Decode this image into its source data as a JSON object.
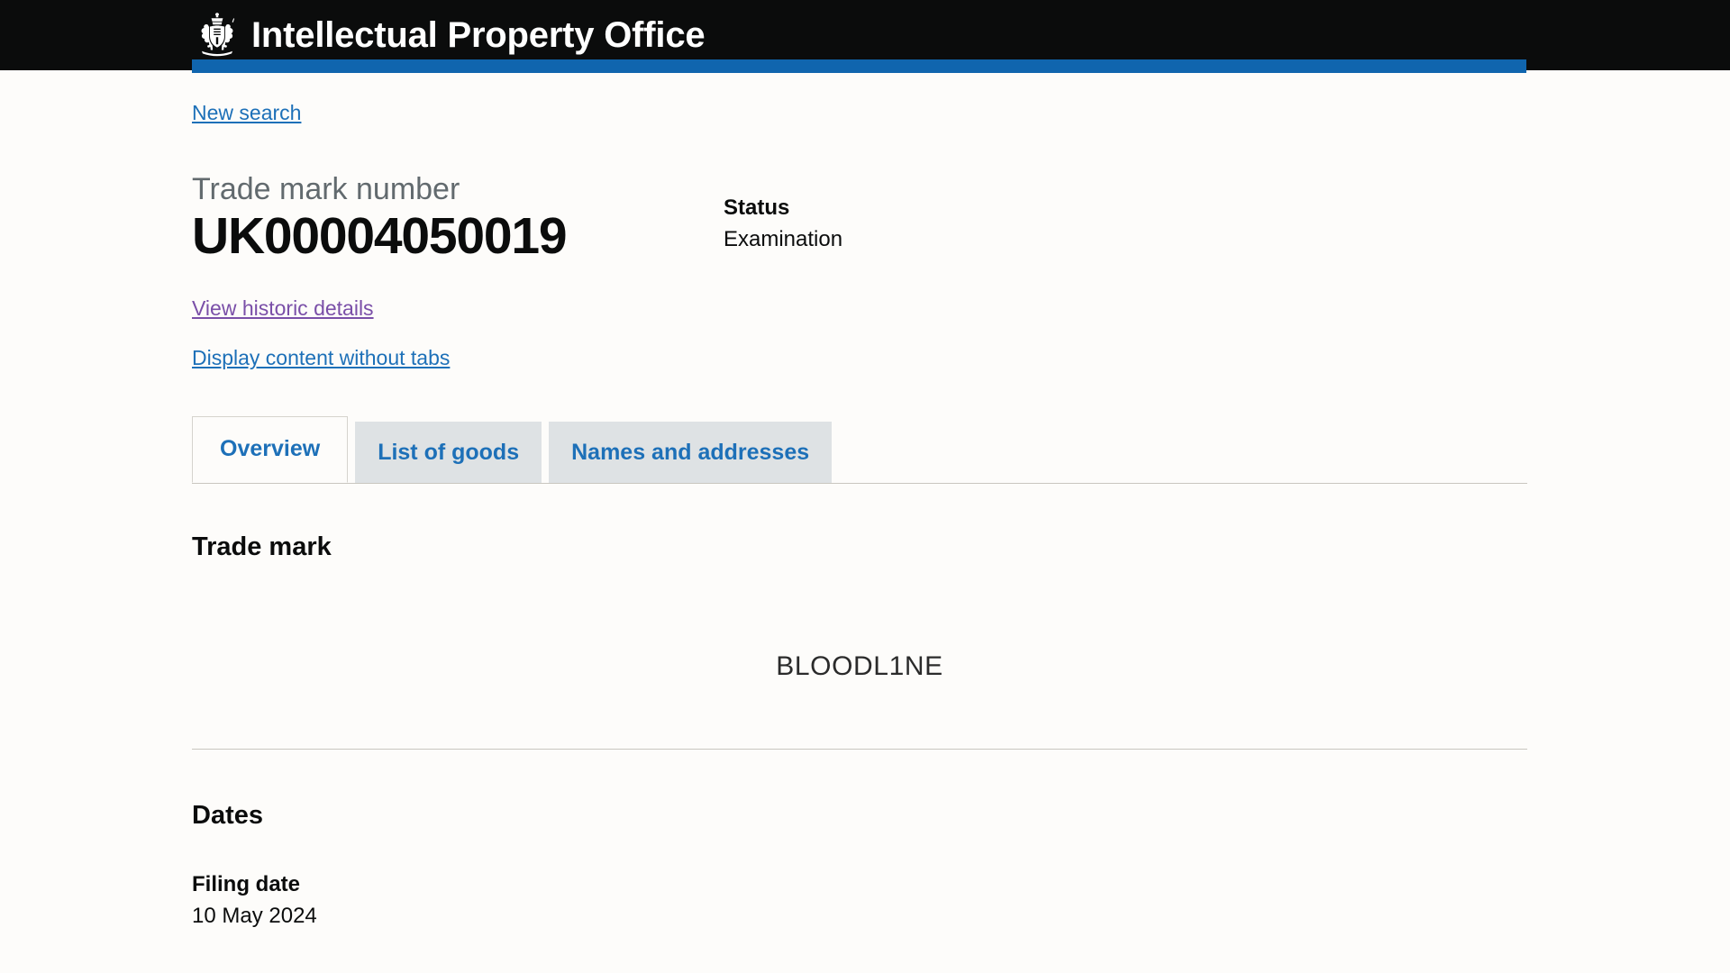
{
  "header": {
    "logo_icon": "royal-crest-icon",
    "title": "Intellectual Property Office",
    "background_color": "#0b0c0c",
    "accent_color": "#1065ae"
  },
  "nav": {
    "new_search_label": "New search"
  },
  "summary": {
    "trade_mark_number_label": "Trade mark number",
    "trade_mark_number_value": "UK00004050019",
    "status_label": "Status",
    "status_value": "Examination"
  },
  "links": {
    "view_historic_details": "View historic details",
    "display_content_without_tabs": "Display content without tabs",
    "link_color": "#1d70b8",
    "visited_color": "#7a4fa8"
  },
  "tabs": [
    {
      "label": "Overview",
      "active": true
    },
    {
      "label": "List of goods",
      "active": false
    },
    {
      "label": "Names and addresses",
      "active": false
    }
  ],
  "panel": {
    "trade_mark_heading": "Trade mark",
    "trade_mark_text": "BLOODL1NE",
    "dates_heading": "Dates",
    "filing_date_label": "Filing date",
    "filing_date_value": "10 May 2024"
  }
}
